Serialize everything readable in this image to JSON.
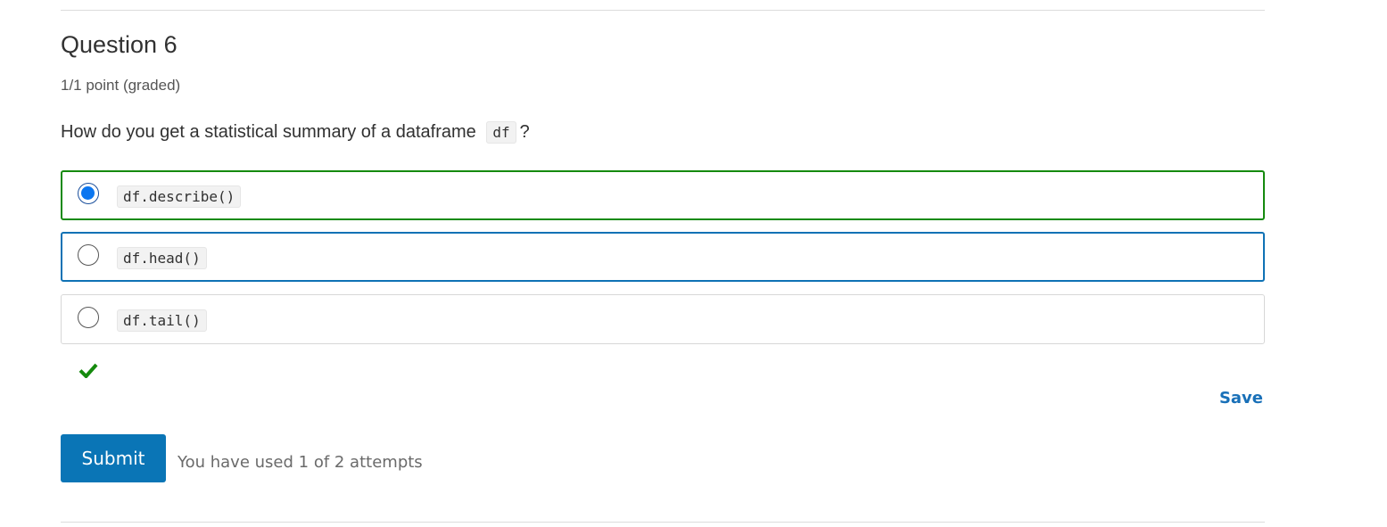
{
  "question": {
    "title": "Question 6",
    "points": "1/1 point (graded)",
    "prompt_text": "How do you get a statistical summary of a dataframe",
    "prompt_code": "df",
    "prompt_end": "?"
  },
  "choices": [
    {
      "code": "df.describe()",
      "selected": true,
      "state": "correct"
    },
    {
      "code": "df.head()",
      "selected": false,
      "state": "focused"
    },
    {
      "code": "df.tail()",
      "selected": false,
      "state": "default"
    }
  ],
  "feedback": {
    "icon": "checkmark-icon",
    "color": "#158a0e"
  },
  "actions": {
    "save_label": "Save",
    "submit_label": "Submit",
    "attempts_text": "You have used 1 of 2 attempts"
  },
  "colors": {
    "correct_border": "#158a0e",
    "focus_border": "#0f72b5",
    "primary_button": "#0a75b6",
    "link": "#1970b8",
    "radio_selected": "#0b76f0"
  }
}
